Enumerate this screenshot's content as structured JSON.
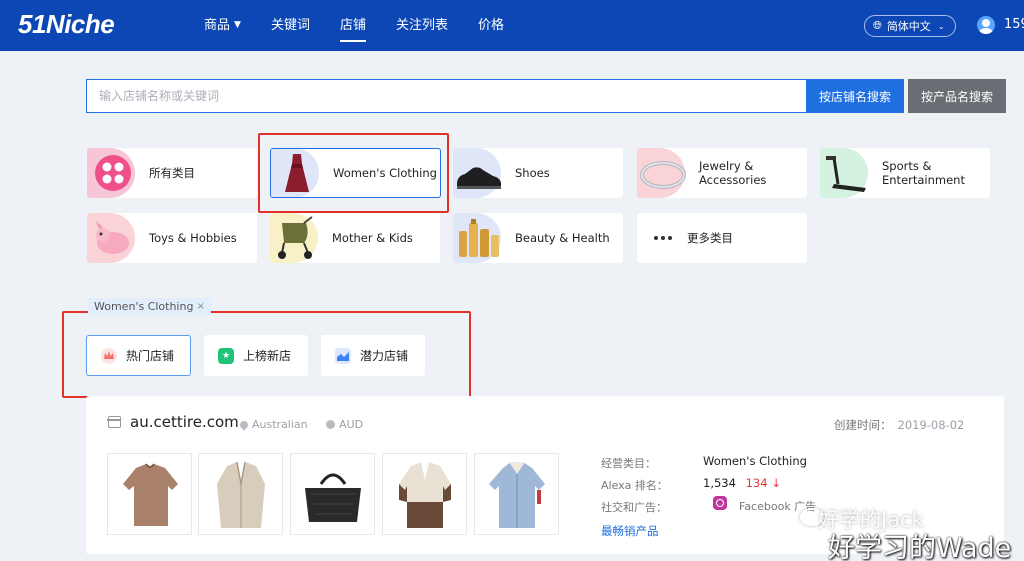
{
  "header": {
    "logo": "51Niche",
    "nav": [
      "商品",
      "关键词",
      "店铺",
      "关注列表",
      "价格"
    ],
    "active_nav": "店铺",
    "language": "简体中文",
    "user_text": "159"
  },
  "search": {
    "placeholder": "输入店铺名称或关键词",
    "value": "",
    "store_button": "按店铺名搜索",
    "product_button": "按产品名搜索"
  },
  "categories": [
    {
      "label": "所有类目",
      "icon": "grid-icon",
      "color": "#f7c6d6"
    },
    {
      "label": "Women's Clothing",
      "icon": "dress-icon",
      "color": "#dfe6f7",
      "selected": true
    },
    {
      "label": "Shoes",
      "icon": "shoe-icon",
      "color": "#dfe6f7"
    },
    {
      "label": "Jewelry &\nAccessories",
      "icon": "bracelet-icon",
      "color": "#f9d3d6"
    },
    {
      "label": "Sports &\nEntertainment",
      "icon": "treadmill-icon",
      "color": "#d5f1df"
    },
    {
      "label": "Toys & Hobbies",
      "icon": "toy-icon",
      "color": "#f9d3d6"
    },
    {
      "label": "Mother & Kids",
      "icon": "stroller-icon",
      "color": "#f8f1c8"
    },
    {
      "label": "Beauty & Health",
      "icon": "bottles-icon",
      "color": "#dfe6f7"
    },
    {
      "label": "更多类目",
      "icon": "more-icon",
      "color": "#ffffff"
    }
  ],
  "filter_tag": "Women's Clothing",
  "filter_tag_close": "×",
  "subtabs": [
    {
      "label": "热门店铺",
      "icon": "crown-icon",
      "color": "#f3736c"
    },
    {
      "label": "上榜新店",
      "icon": "star-icon",
      "color": "#22c17a"
    },
    {
      "label": "潜力店铺",
      "icon": "trend-icon",
      "color": "#3b82f6"
    }
  ],
  "store": {
    "domain": "au.cettire.com",
    "country": "Australian",
    "currency": "AUD",
    "created_label": "创建时间：",
    "created_value": "2019-08-02",
    "category_label": "经营类目：",
    "category_value": "Women's Clothing",
    "alexa_label": "Alexa 排名：",
    "alexa_value": "1,534",
    "alexa_change": "134 ↓",
    "social_label": "社交和广告：",
    "social_value": "Facebook 广告",
    "best_seller": "最畅销产品"
  },
  "watermark": {
    "line1": "好学的Jack",
    "line2": "好学习的Wade"
  }
}
